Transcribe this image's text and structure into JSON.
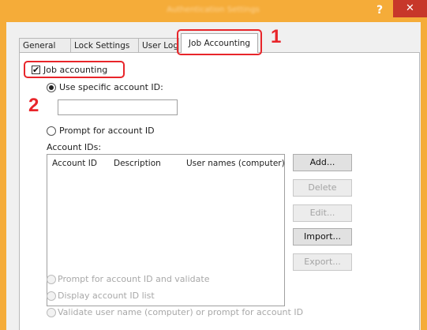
{
  "window": {
    "title": "Authentication Settings",
    "help_label": "?",
    "close_label": "✕"
  },
  "tabs": [
    "General",
    "Lock Settings",
    "User Login",
    "Job Accounting"
  ],
  "callouts": [
    "1",
    "2"
  ],
  "job_accounting": {
    "checkbox_label": "Job accounting",
    "checkbox_mark": "✔",
    "use_specific_label": "Use specific account ID:",
    "account_id_value": "",
    "prompt_label": "Prompt for account ID",
    "account_ids_label": "Account IDs:",
    "columns": [
      "Account ID",
      "Description",
      "User names (computer)"
    ],
    "buttons": {
      "add": "Add...",
      "delete": "Delete",
      "edit": "Edit...",
      "import": "Import...",
      "export": "Export..."
    },
    "option_prompt_validate": "Prompt for account ID and validate",
    "option_display_list": "Display account ID list",
    "option_validate_user": "Validate user name (computer) or prompt for account ID"
  },
  "colors": {
    "title_bar": "#f5ac39",
    "close_button": "#c7372a",
    "callout": "#e8252a"
  }
}
